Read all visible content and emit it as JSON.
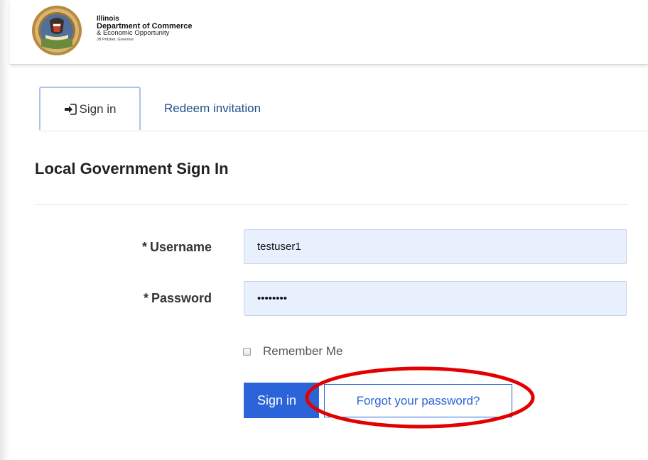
{
  "header": {
    "org_line1": "Illinois",
    "org_line2": "Department of Commerce",
    "org_line3": "& Economic Opportunity",
    "org_line4": "JB Pritzker, Governor",
    "seal_icon": "illinois-state-seal"
  },
  "tabs": {
    "signin_label": "Sign in",
    "signin_icon": "sign-in-icon",
    "redeem_label": "Redeem invitation"
  },
  "page": {
    "title": "Local Government Sign In"
  },
  "form": {
    "username_label": "Username",
    "username_value": "testuser1",
    "password_label": "Password",
    "password_value": "••••••••",
    "required_marker": "*",
    "remember_label": "Remember Me",
    "remember_checked": false,
    "signin_button": "Sign in",
    "forgot_button": "Forgot your password?"
  },
  "colors": {
    "primary": "#2b64d8",
    "link": "#1f4f86",
    "input_bg": "#e8f0fe",
    "annotation": "#e30000"
  }
}
